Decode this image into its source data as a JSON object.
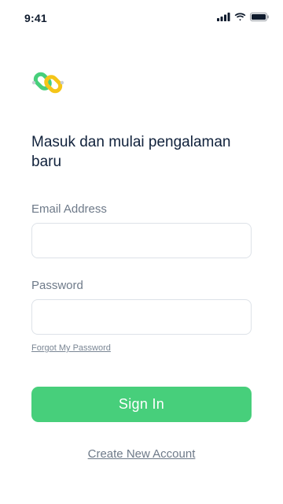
{
  "status_bar": {
    "time": "9:41",
    "icons": [
      "signal-icon",
      "wifi-icon",
      "battery-icon"
    ]
  },
  "brand": {
    "logo_icon": "chain-link-logo",
    "colors": {
      "green": "#47cf7b",
      "yellow": "#f5c518",
      "accent_gray": "#c8ced6"
    }
  },
  "login": {
    "headline": "Masuk dan mulai pengalaman baru",
    "email_label": "Email Address",
    "email_value": "",
    "password_label": "Password",
    "password_value": "",
    "forgot_password": "Forgot My Password",
    "sign_in_label": "Sign In",
    "create_account": "Create New Account"
  },
  "theme": {
    "primary_button": "#47cf7b",
    "text_dark": "#10213b",
    "text_muted": "#6e7a89",
    "input_border": "#dde2e8"
  }
}
